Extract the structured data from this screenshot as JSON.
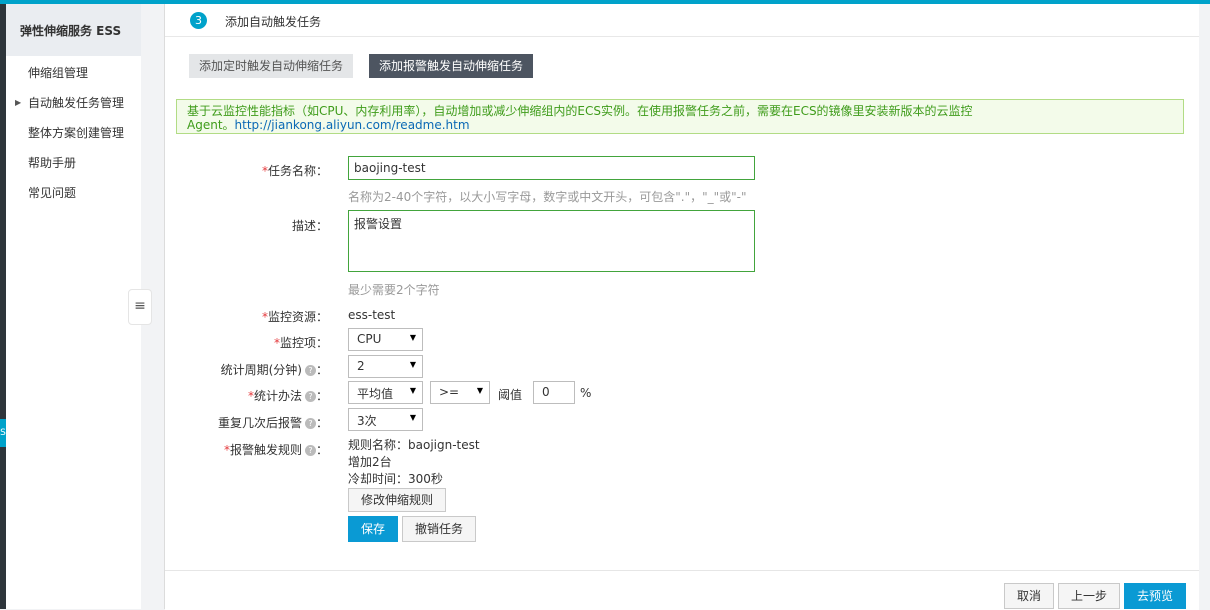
{
  "sidebar": {
    "title": "弹性伸缩服务 ESS",
    "items": [
      {
        "label": "伸缩组管理"
      },
      {
        "label": "自动触发任务管理"
      },
      {
        "label": "整体方案创建管理"
      },
      {
        "label": "帮助手册"
      },
      {
        "label": "常见问题"
      }
    ],
    "collapse_icon": "menu-icon"
  },
  "step": {
    "number": "3",
    "label": "添加自动触发任务"
  },
  "tabs": {
    "timer": "添加定时触发自动伸缩任务",
    "alarm": "添加报警触发自动伸缩任务"
  },
  "notice": {
    "line1": "基于云监控性能指标（如CPU、内存利用率），自动增加或减少伸缩组内的ECS实例。在使用报警任务之前，需要在ECS的镜像里安装新版本的云监控",
    "line2_prefix": "Agent。",
    "link": "http://jiankong.aliyun.com/readme.htm"
  },
  "form": {
    "task_name": {
      "label": "任务名称：",
      "value": "baojing-test",
      "hint": "名称为2-40个字符，以大小写字母，数字或中文开头，可包含\".\"，\"_\"或\"-\""
    },
    "description": {
      "label": "描述：",
      "value": "报警设置",
      "hint": "最少需要2个字符"
    },
    "monitor_resource": {
      "label": "监控资源：",
      "value": "ess-test"
    },
    "monitor_item": {
      "label": "监控项：",
      "value": "CPU"
    },
    "period": {
      "label": "统计周期(分钟)",
      "value": "2"
    },
    "method": {
      "label": "统计办法",
      "value": "平均值",
      "operator": ">=",
      "threshold_label": "阈值",
      "threshold_value": "0",
      "unit": "%"
    },
    "repeat": {
      "label": "重复几次后报警",
      "value": "3次"
    },
    "rule": {
      "label": "报警触发规则",
      "name_line": "规则名称：baojign-test",
      "add_line": "增加2台",
      "cooldown_line": "冷却时间：300秒",
      "modify_button": "修改伸缩规则"
    },
    "save_button": "保存",
    "cancel_task_button": "撤销任务"
  },
  "footer": {
    "cancel": "取消",
    "prev": "上一步",
    "preview": "去预览"
  },
  "colors": {
    "accent": "#00a2ca",
    "primary_button": "#0a9ad4",
    "required": "#e4393c",
    "notice_text": "#3f9c1b"
  }
}
